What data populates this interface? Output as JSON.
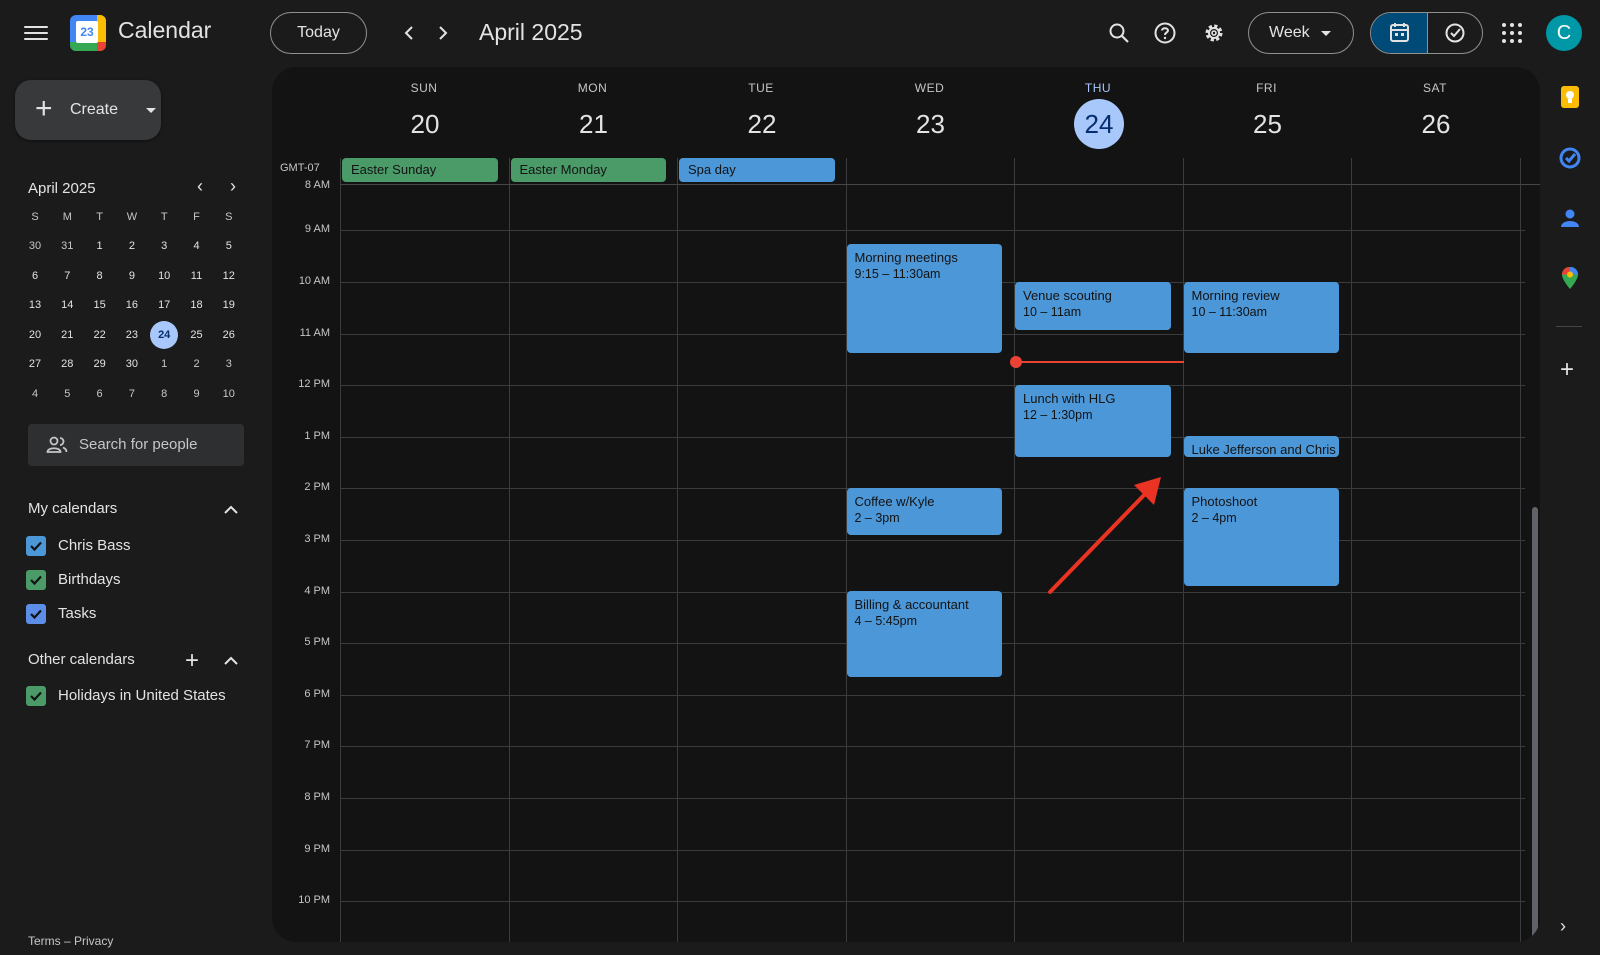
{
  "header": {
    "app_title": "Calendar",
    "logo_day": "23",
    "today_label": "Today",
    "prev_label": "‹",
    "next_label": "›",
    "month_title": "April 2025",
    "view_label": "Week",
    "avatar_letter": "C"
  },
  "sidebar": {
    "create_label": "Create",
    "mini_calendar": {
      "title": "April 2025",
      "prev": "‹",
      "next": "›",
      "weekdays": [
        "S",
        "M",
        "T",
        "W",
        "T",
        "F",
        "S"
      ],
      "weeks": [
        [
          {
            "d": "30",
            "m": true
          },
          {
            "d": "31",
            "m": true
          },
          {
            "d": "1"
          },
          {
            "d": "2"
          },
          {
            "d": "3"
          },
          {
            "d": "4"
          },
          {
            "d": "5"
          }
        ],
        [
          {
            "d": "6"
          },
          {
            "d": "7"
          },
          {
            "d": "8"
          },
          {
            "d": "9"
          },
          {
            "d": "10"
          },
          {
            "d": "11"
          },
          {
            "d": "12"
          }
        ],
        [
          {
            "d": "13"
          },
          {
            "d": "14"
          },
          {
            "d": "15"
          },
          {
            "d": "16"
          },
          {
            "d": "17"
          },
          {
            "d": "18"
          },
          {
            "d": "19"
          }
        ],
        [
          {
            "d": "20"
          },
          {
            "d": "21"
          },
          {
            "d": "22"
          },
          {
            "d": "23"
          },
          {
            "d": "24",
            "today": true
          },
          {
            "d": "25"
          },
          {
            "d": "26"
          }
        ],
        [
          {
            "d": "27"
          },
          {
            "d": "28"
          },
          {
            "d": "29"
          },
          {
            "d": "30"
          },
          {
            "d": "1",
            "m": true
          },
          {
            "d": "2",
            "m": true
          },
          {
            "d": "3",
            "m": true
          }
        ],
        [
          {
            "d": "4",
            "m": true
          },
          {
            "d": "5",
            "m": true
          },
          {
            "d": "6",
            "m": true
          },
          {
            "d": "7",
            "m": true
          },
          {
            "d": "8",
            "m": true
          },
          {
            "d": "9",
            "m": true
          },
          {
            "d": "10",
            "m": true
          }
        ]
      ]
    },
    "search_people_placeholder": "Search for people",
    "my_calendars_title": "My calendars",
    "my_calendars": [
      {
        "label": "Chris Bass",
        "color": "#4c97d8"
      },
      {
        "label": "Birthdays",
        "color": "#4a9b68"
      },
      {
        "label": "Tasks",
        "color": "#5c8ee8"
      }
    ],
    "other_calendars_title": "Other calendars",
    "other_calendars": [
      {
        "label": "Holidays in United States",
        "color": "#4a9b68"
      }
    ],
    "footer": "Terms – Privacy"
  },
  "week": {
    "timezone": "GMT-07",
    "days": [
      {
        "name": "SUN",
        "date": "20"
      },
      {
        "name": "MON",
        "date": "21"
      },
      {
        "name": "TUE",
        "date": "22"
      },
      {
        "name": "WED",
        "date": "23"
      },
      {
        "name": "THU",
        "date": "24",
        "today": true
      },
      {
        "name": "FRI",
        "date": "25"
      },
      {
        "name": "SAT",
        "date": "26"
      }
    ],
    "hours": [
      "8 AM",
      "9 AM",
      "10 AM",
      "11 AM",
      "12 PM",
      "1 PM",
      "2 PM",
      "3 PM",
      "4 PM",
      "5 PM",
      "6 PM",
      "7 PM",
      "8 PM",
      "9 PM",
      "10 PM"
    ],
    "all_day_events": [
      {
        "title": "Easter Sunday",
        "color": "green"
      },
      {
        "title": "Easter Monday",
        "color": "green"
      },
      {
        "title": "Spa day",
        "color": "blue"
      }
    ],
    "events": [
      {
        "title": "Morning meetings",
        "time": "9:15 – 11:30am"
      },
      {
        "title": "Venue scouting",
        "time": "10 – 11am"
      },
      {
        "title": "Morning review",
        "time": "10 – 11:30am"
      },
      {
        "title": "Lunch with HLG",
        "time": "12 – 1:30pm"
      },
      {
        "title": "Luke Jefferson and Chris",
        "time": ""
      },
      {
        "title": "Coffee w/Kyle",
        "time": "2 – 3pm"
      },
      {
        "title": "Photoshoot",
        "time": "2 – 4pm"
      },
      {
        "title": "Billing & accountant",
        "time": "4 – 5:45pm"
      }
    ]
  },
  "colors": {
    "accent": "#a8c7fa",
    "event_blue": "#4c97d8",
    "event_green": "#4a9b68",
    "now_line": "#ea4335",
    "annotation_arrow": "#ea3323"
  }
}
